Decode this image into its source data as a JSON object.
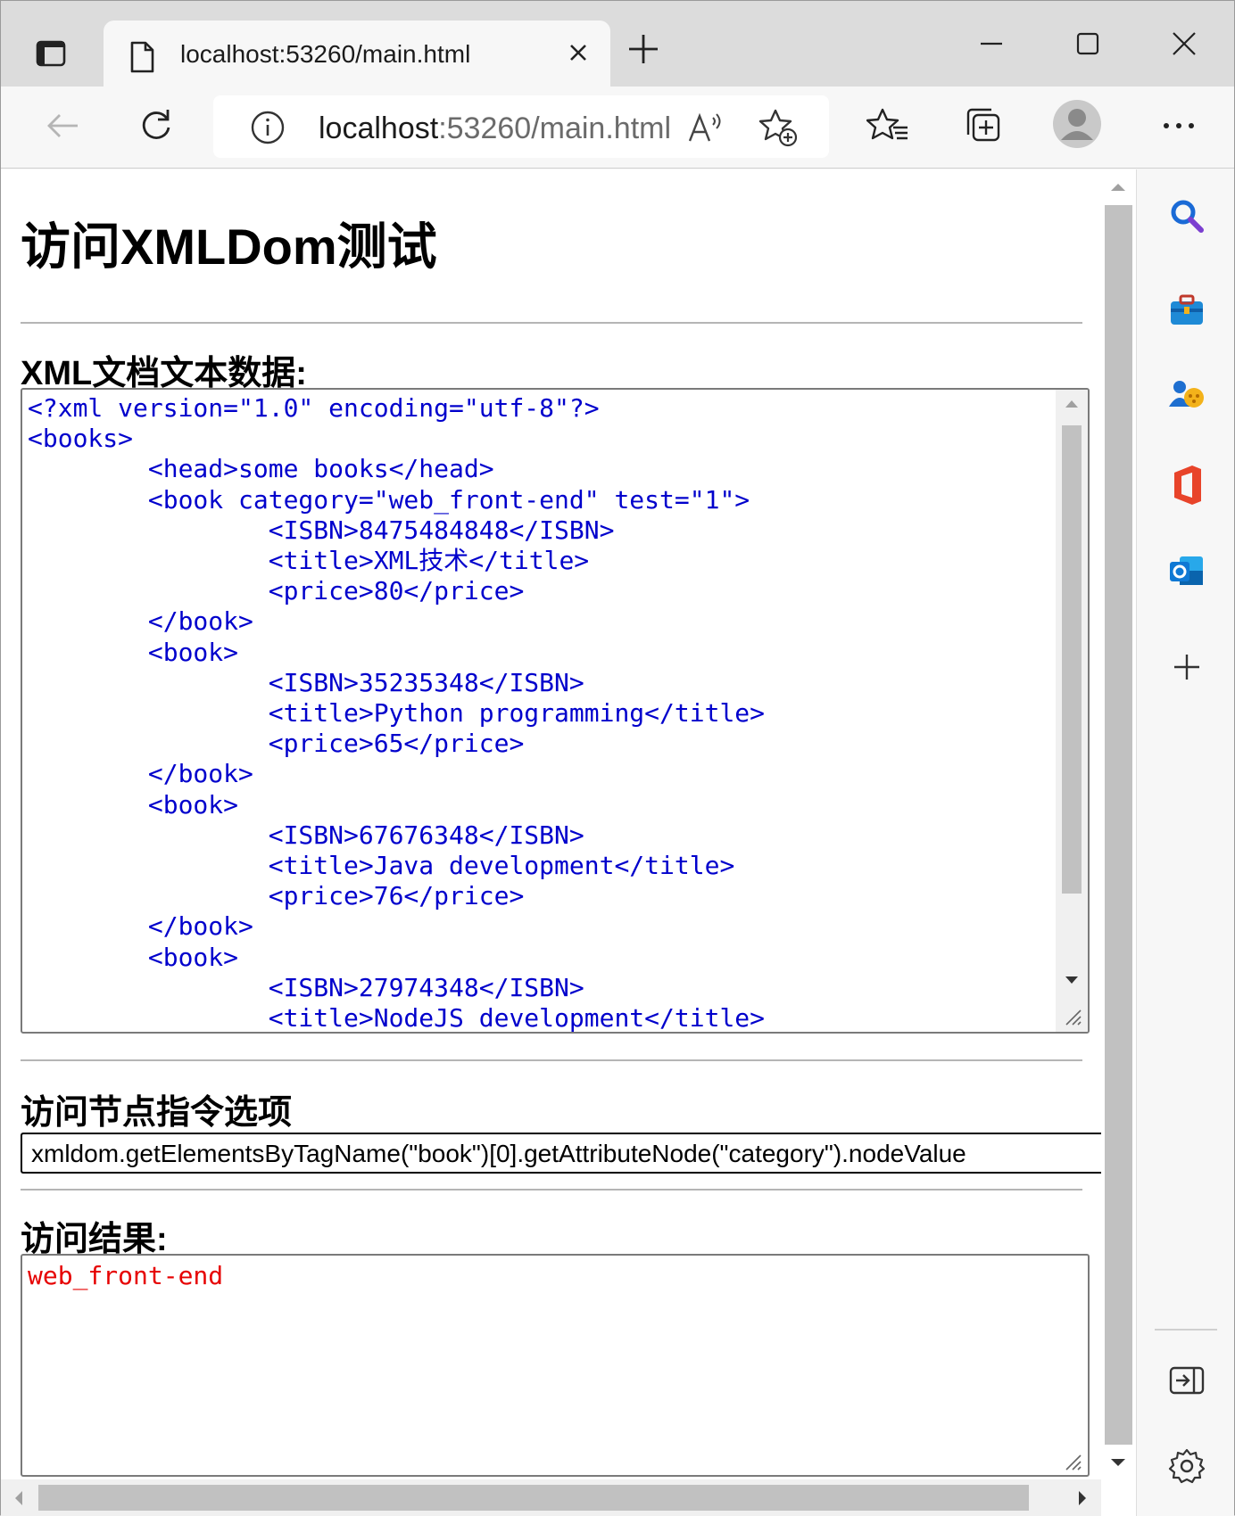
{
  "browser": {
    "tab_title": "localhost:53260/main.html",
    "url_host": "localhost",
    "url_rest": ":53260/main.html"
  },
  "page": {
    "heading": "访问XMLDom测试",
    "xml_section_title": "XML文档文本数据:",
    "xml_lines": [
      "<?xml version=\"1.0\" encoding=\"utf-8\"?>",
      "<books>",
      "        <head>some books</head>",
      "        <book category=\"web_front-end\" test=\"1\">",
      "                <ISBN>8475484848</ISBN>",
      "                <title>XML技术</title>",
      "                <price>80</price>",
      "        </book>",
      "        <book>",
      "                <ISBN>35235348</ISBN>",
      "                <title>Python programming</title>",
      "                <price>65</price>",
      "        </book>",
      "        <book>",
      "                <ISBN>67676348</ISBN>",
      "                <title>Java development</title>",
      "                <price>76</price>",
      "        </book>",
      "        <book>",
      "                <ISBN>27974348</ISBN>",
      "                <title>NodeJS development</title>"
    ],
    "command_section_title": "访问节点指令选项",
    "command_value": "xmldom.getElementsByTagName(\"book\")[0].getAttributeNode(\"category\").nodeValue",
    "result_section_title": "访问结果:",
    "result_value": "web_front-end"
  }
}
